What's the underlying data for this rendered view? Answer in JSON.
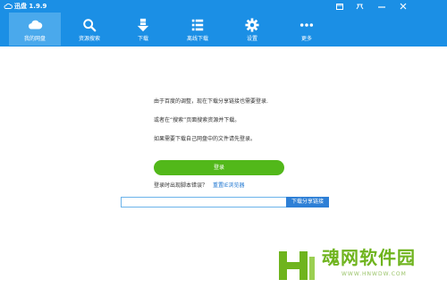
{
  "window": {
    "title": "迅盘 1.9.9",
    "controls": [
      "restore-icon",
      "pin-icon",
      "minimize-icon",
      "close-icon"
    ]
  },
  "toolbar": {
    "tabs": [
      {
        "label": "我的网盘",
        "icon": "cloud-icon",
        "active": true
      },
      {
        "label": "资源搜索",
        "icon": "search-icon",
        "active": false
      },
      {
        "label": "下载",
        "icon": "download-icon",
        "active": false
      },
      {
        "label": "离线下载",
        "icon": "list-icon",
        "active": false
      },
      {
        "label": "设置",
        "icon": "gear-icon",
        "active": false
      },
      {
        "label": "更多",
        "icon": "more-icon",
        "active": false
      }
    ]
  },
  "main": {
    "message_line1": "由于百度的调整，现在下载分享链接也需要登录.",
    "message_line2": "或者在“搜索”页面搜索资源并下载。",
    "message_line3": "如果需要下载自己网盘中的文件请先登录。",
    "login_button": "登录",
    "login_problem": "登录时出现脚本错误？",
    "reset_browser": "重置IE浏览器",
    "share_input_value": "",
    "share_input_placeholder": "",
    "share_download_button": "下载分享链接"
  },
  "watermark": {
    "title": "魂网软件园",
    "url": "WWW.HNWDW.COM"
  },
  "colors": {
    "titlebar": "#1b8fe5",
    "active_tab": "#4aa9ec",
    "login_button": "#52b81a",
    "link": "#1b74d0",
    "watermark": "#6fb41e"
  }
}
